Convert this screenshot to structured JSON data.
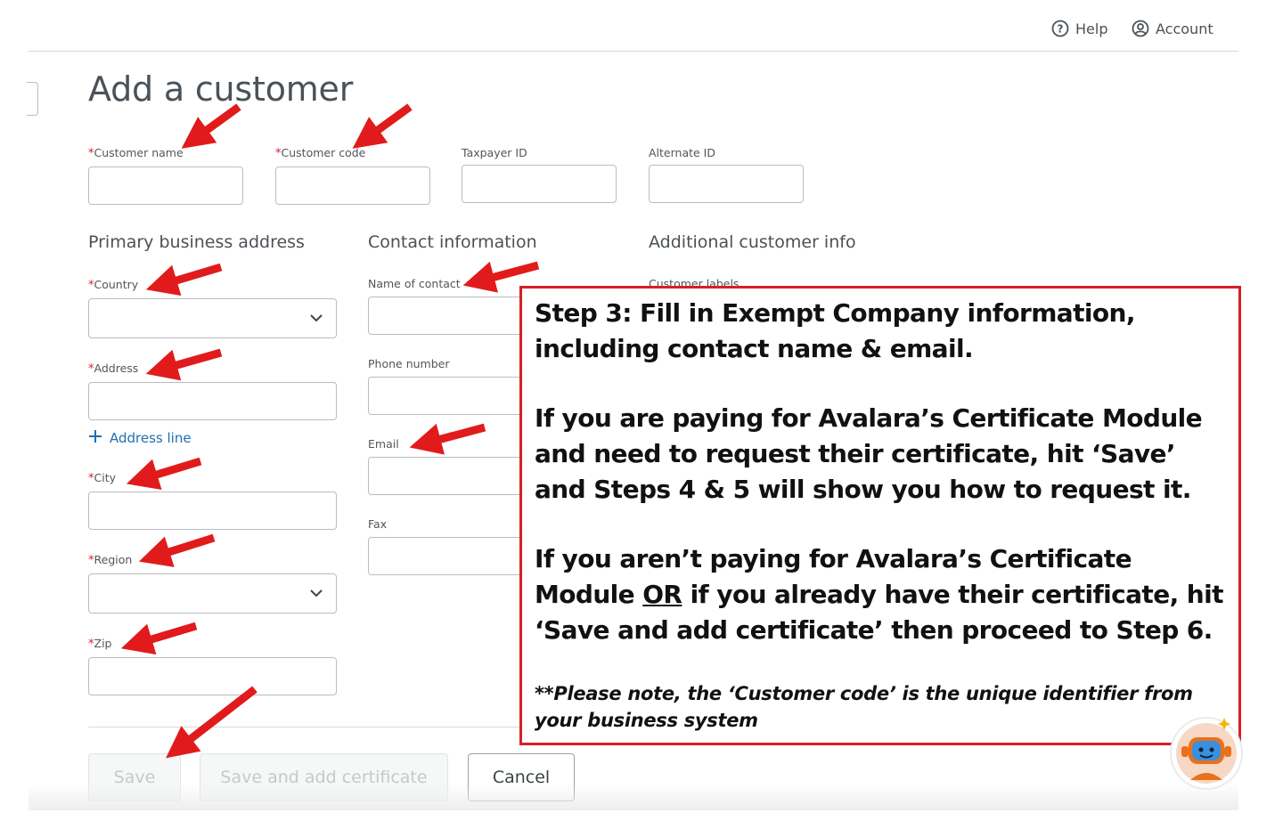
{
  "header": {
    "help_label": "Help",
    "account_label": "Account"
  },
  "page": {
    "title": "Add a customer"
  },
  "fields": {
    "customer_name": {
      "label": "Customer name",
      "required": true,
      "value": ""
    },
    "customer_code": {
      "label": "Customer code",
      "required": true,
      "value": ""
    },
    "taxpayer_id": {
      "label": "Taxpayer ID",
      "required": false,
      "value": ""
    },
    "alternate_id": {
      "label": "Alternate ID",
      "required": false,
      "value": ""
    }
  },
  "sections": {
    "address": {
      "title": "Primary business address",
      "country": {
        "label": "Country",
        "required": true,
        "value": ""
      },
      "address": {
        "label": "Address",
        "required": true,
        "value": ""
      },
      "add_line": "Address line",
      "city": {
        "label": "City",
        "required": true,
        "value": ""
      },
      "region": {
        "label": "Region",
        "required": true,
        "value": ""
      },
      "zip": {
        "label": "Zip",
        "required": true,
        "value": ""
      }
    },
    "contact": {
      "title": "Contact information",
      "name": {
        "label": "Name of contact",
        "value": ""
      },
      "phone": {
        "label": "Phone number",
        "value": ""
      },
      "email": {
        "label": "Email",
        "value": ""
      },
      "fax": {
        "label": "Fax",
        "value": ""
      }
    },
    "additional": {
      "title": "Additional customer info",
      "labels": {
        "label": "Customer labels",
        "value": ""
      }
    }
  },
  "buttons": {
    "save": "Save",
    "save_and_add": "Save and add certificate",
    "cancel": "Cancel"
  },
  "callout": {
    "line1": "Step 3: Fill in Exempt Company information,",
    "line2": "including contact name & email.",
    "para2": "If you are paying for Avalara’s Certificate Module and need to request their certificate, hit ‘Save’ and Steps 4 & 5 will show you how to request it.",
    "para3_lead": "If you aren’t paying for Avalara’s Certificate Module",
    "para3_or": "OR",
    "para3_rest": "if you already have their certificate, hit ‘Save and add certificate’ then proceed to Step 6.",
    "note": "**Please note, the ‘Customer code’ is the unique identifier from your business system"
  },
  "colors": {
    "arrow": "#e11b1b",
    "callout_border": "#d61f26",
    "link": "#1f6fb2",
    "required_mark": "#d1222a"
  }
}
